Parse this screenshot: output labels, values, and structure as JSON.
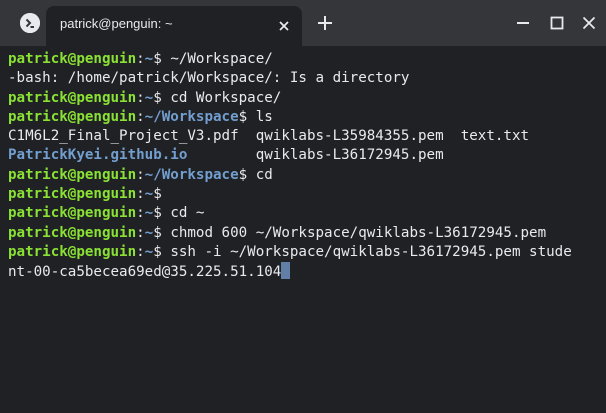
{
  "window": {
    "tab_title": "patrick@penguin: ~",
    "icons": {
      "app": "terminal-app-icon",
      "tab_close": "close-icon",
      "new_tab": "plus-icon",
      "minimize": "minimize-icon",
      "maximize": "maximize-icon",
      "close": "close-icon"
    }
  },
  "terminal": {
    "colors": {
      "background": "#202124",
      "user": "#8ae234",
      "path": "#729fcf",
      "text": "#e8eaed"
    },
    "lines": [
      {
        "user": "patrick@penguin",
        "sep": ":",
        "path": "~",
        "end": "$ ",
        "cmd": "~/Workspace/"
      },
      {
        "text": "-bash: /home/patrick/Workspace/: Is a directory"
      },
      {
        "user": "patrick@penguin",
        "sep": ":",
        "path": "~",
        "end": "$ ",
        "cmd": "cd Workspace/"
      },
      {
        "user": "patrick@penguin",
        "sep": ":",
        "path": "~/Workspace",
        "end": "$ ",
        "cmd": "ls"
      },
      {
        "c1": "C1M6L2_Final_Project_V3.pdf  ",
        "c2": "qwiklabs-L35984355.pem  ",
        "c3": "text.txt"
      },
      {
        "dir": "PatrickKyei.github.io",
        "pad": "        ",
        "c2": "qwiklabs-L36172945.pem"
      },
      {
        "user": "patrick@penguin",
        "sep": ":",
        "path": "~/Workspace",
        "end": "$ ",
        "cmd": "cd"
      },
      {
        "user": "patrick@penguin",
        "sep": ":",
        "path": "~",
        "end": "$",
        "cmd": ""
      },
      {
        "user": "patrick@penguin",
        "sep": ":",
        "path": "~",
        "end": "$ ",
        "cmd": "cd ~"
      },
      {
        "user": "patrick@penguin",
        "sep": ":",
        "path": "~",
        "end": "$ ",
        "cmd": "chmod 600 ~/Workspace/qwiklabs-L36172945.pem"
      },
      {
        "user": "patrick@penguin",
        "sep": ":",
        "path": "~",
        "end": "$ ",
        "cmd": "ssh -i ~/Workspace/qwiklabs-L36172945.pem stude"
      },
      {
        "text": "nt-00-ca5becea69ed@35.225.51.104"
      }
    ]
  }
}
